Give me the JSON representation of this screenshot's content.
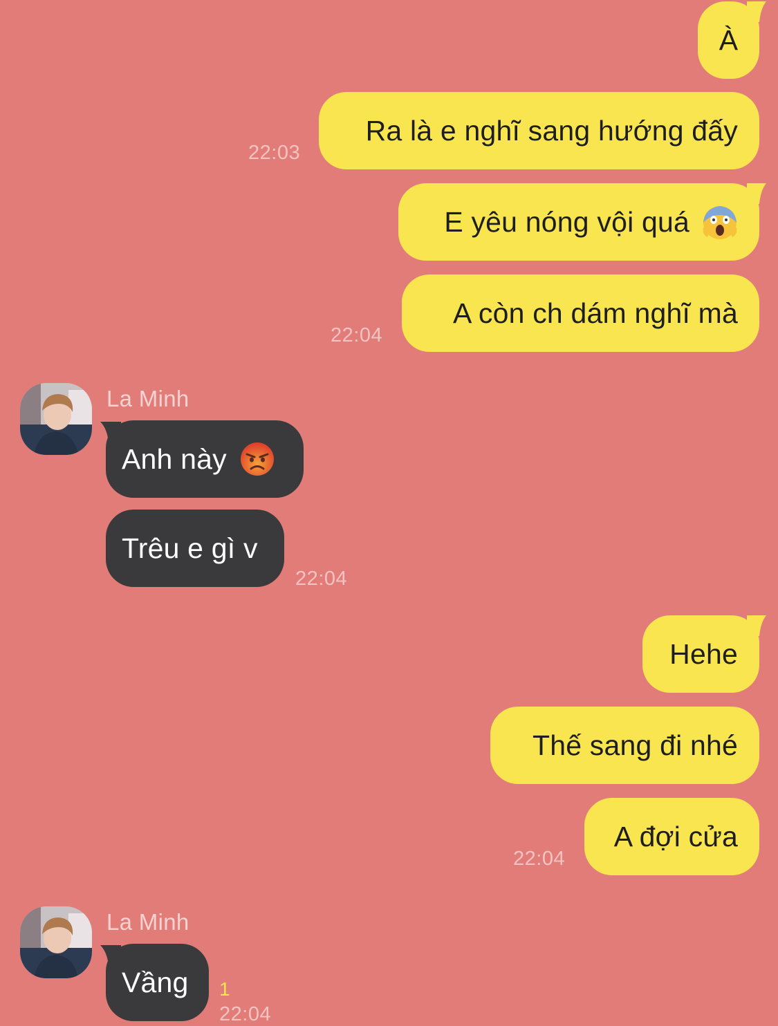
{
  "contact": {
    "name": "La Minh"
  },
  "messages": [
    {
      "sender": "me",
      "text": "À"
    },
    {
      "sender": "me",
      "text": "Ra là e nghĩ sang hướng đấy",
      "time": "22:03"
    },
    {
      "sender": "me",
      "text": "E yêu nóng vội quá",
      "emoji": "face-screaming-in-fear-icon"
    },
    {
      "sender": "me",
      "text": "A còn ch dám nghĩ mà",
      "time": "22:04"
    },
    {
      "sender": "them",
      "text": "Anh này",
      "emoji": "pouting-face-icon"
    },
    {
      "sender": "them",
      "text": "Trêu e gì v",
      "time": "22:04"
    },
    {
      "sender": "me",
      "text": "Hehe"
    },
    {
      "sender": "me",
      "text": "Thế sang đi nhé"
    },
    {
      "sender": "me",
      "text": "A đợi cửa",
      "time": "22:04"
    },
    {
      "sender": "them",
      "text": "Vầng",
      "time": "22:04",
      "unread_count": "1"
    }
  ],
  "colors": {
    "background": "#E27C79",
    "my_bubble": "#F9E54F",
    "their_bubble": "#3A3A3C",
    "unread": "#F9E54F"
  }
}
